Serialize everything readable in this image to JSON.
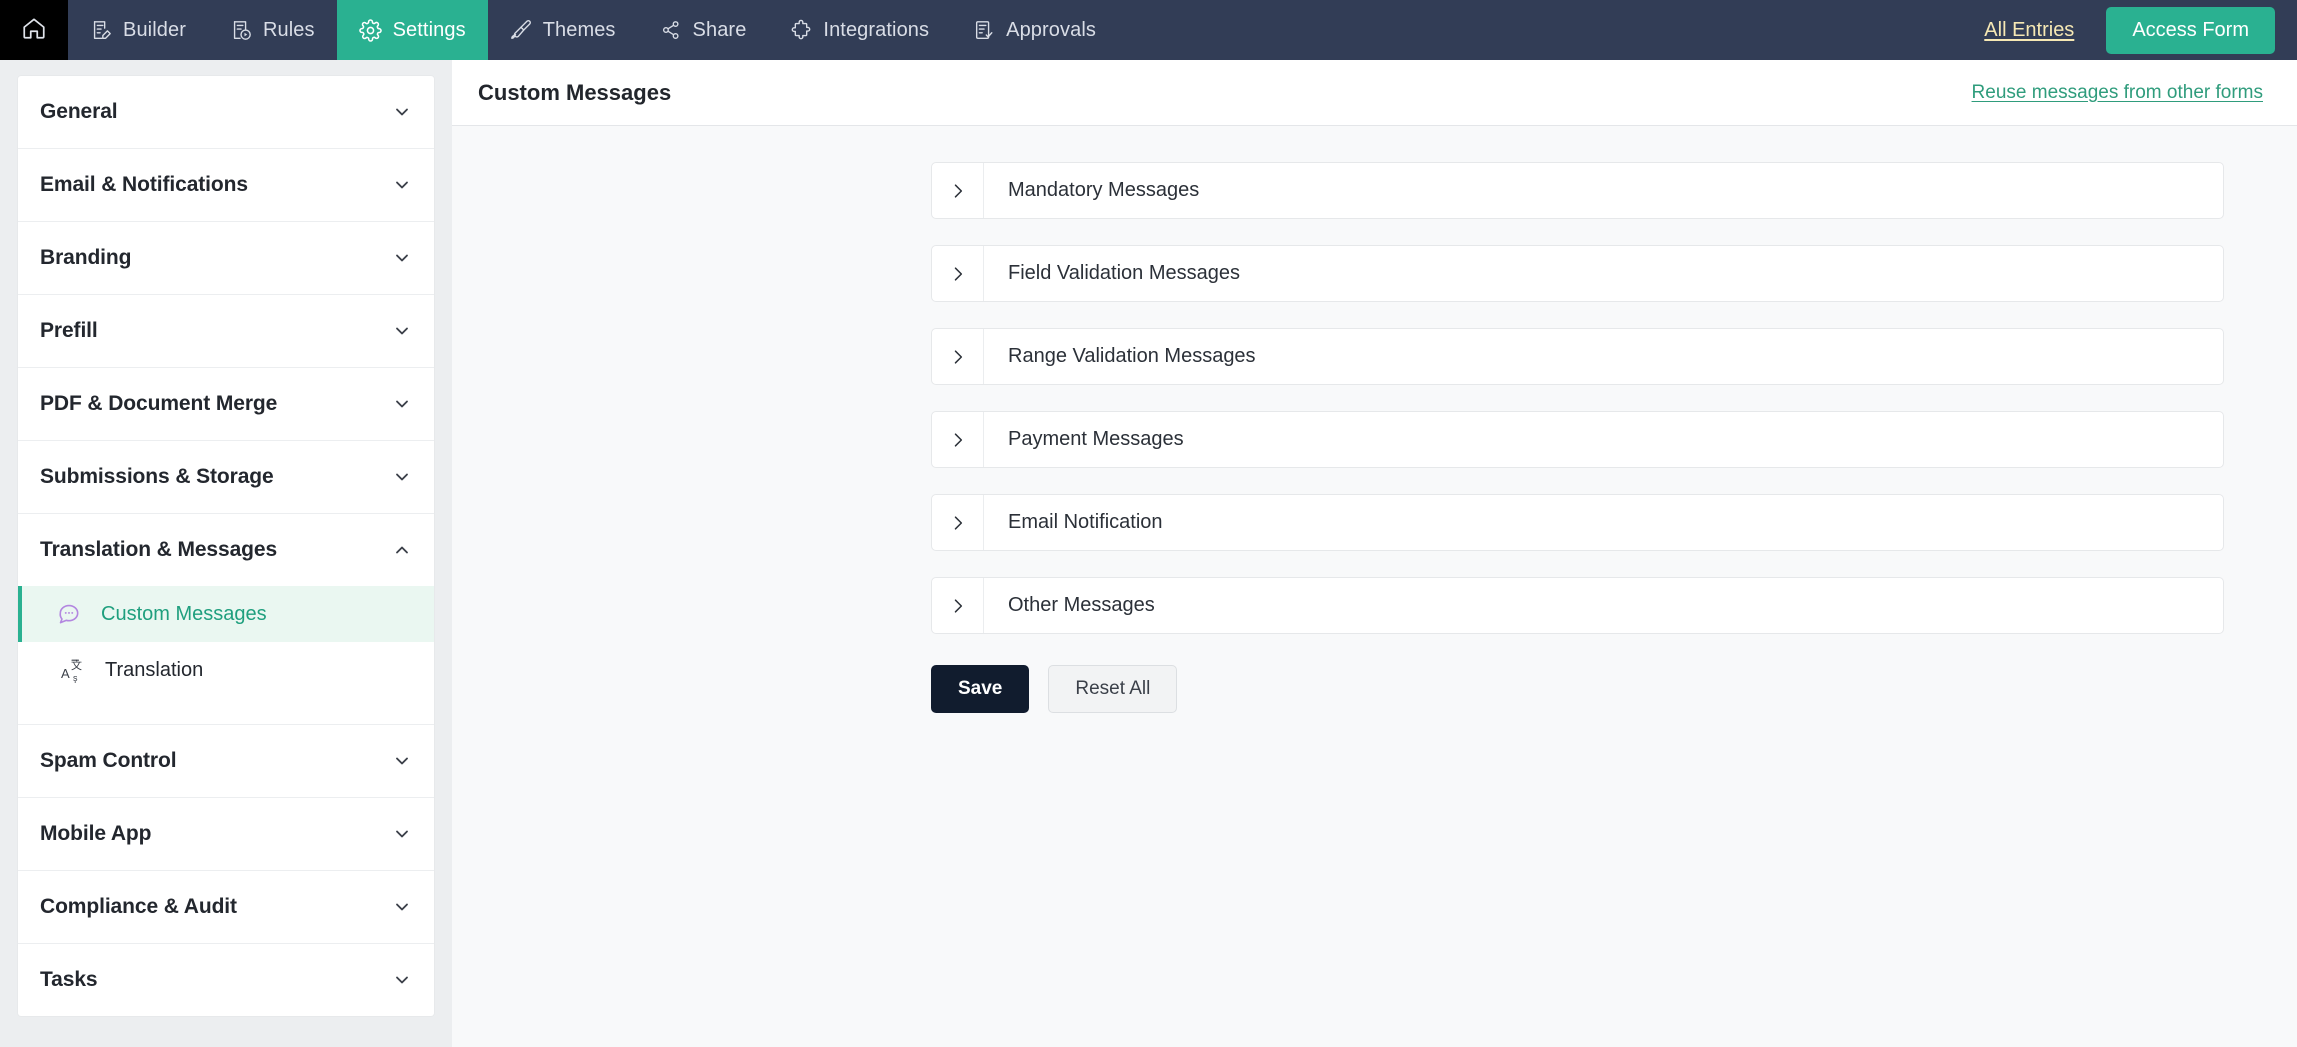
{
  "topbar": {
    "home_icon": "home-icon",
    "tabs": [
      {
        "label": "Builder",
        "icon": "form-builder-icon",
        "active": false
      },
      {
        "label": "Rules",
        "icon": "rules-icon",
        "active": false
      },
      {
        "label": "Settings",
        "icon": "gear-icon",
        "active": true
      },
      {
        "label": "Themes",
        "icon": "paint-brush-icon",
        "active": false
      },
      {
        "label": "Share",
        "icon": "share-nodes-icon",
        "active": false
      },
      {
        "label": "Integrations",
        "icon": "puzzle-piece-icon",
        "active": false
      },
      {
        "label": "Approvals",
        "icon": "document-check-icon",
        "active": false
      }
    ],
    "all_entries_label": "All Entries",
    "access_form_label": "Access Form",
    "accent_color": "#2ab191",
    "bar_color": "#323d56",
    "all_entries_color": "#f6e8b4"
  },
  "sidebar": {
    "groups": [
      {
        "label": "General",
        "expanded": false
      },
      {
        "label": "Email & Notifications",
        "expanded": false
      },
      {
        "label": "Branding",
        "expanded": false
      },
      {
        "label": "Prefill",
        "expanded": false
      },
      {
        "label": "PDF & Document Merge",
        "expanded": false
      },
      {
        "label": "Submissions & Storage",
        "expanded": false
      },
      {
        "label": "Translation & Messages",
        "expanded": true
      },
      {
        "label": "Spam Control",
        "expanded": false
      },
      {
        "label": "Mobile App",
        "expanded": false
      },
      {
        "label": "Compliance & Audit",
        "expanded": false
      },
      {
        "label": "Tasks",
        "expanded": false
      }
    ],
    "translation_items": [
      {
        "label": "Custom Messages",
        "icon": "speech-bubble-icon",
        "active": true
      },
      {
        "label": "Translation",
        "icon": "translate-icon",
        "active": false
      }
    ],
    "active_color": "#1f9f7e",
    "active_bg": "#eaf7f1"
  },
  "main": {
    "title": "Custom Messages",
    "reuse_link": "Reuse messages from other forms",
    "accordions": [
      {
        "label": "Mandatory Messages"
      },
      {
        "label": "Field Validation Messages"
      },
      {
        "label": "Range Validation Messages"
      },
      {
        "label": "Payment Messages"
      },
      {
        "label": "Email Notification"
      },
      {
        "label": "Other Messages"
      }
    ],
    "save_label": "Save",
    "reset_label": "Reset All"
  }
}
